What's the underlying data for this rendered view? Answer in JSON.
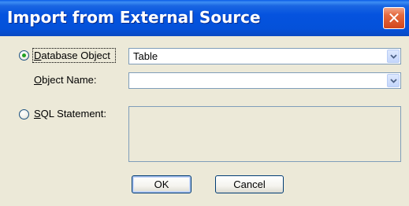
{
  "window": {
    "title": "Import from External Source",
    "close_glyph": "✕"
  },
  "options": {
    "database_object": {
      "label_mnemonic": "D",
      "label_rest": "atabase Object",
      "selected": true
    },
    "object_name": {
      "label_mnemonic": "O",
      "label_rest": "bject Name:"
    },
    "sql_statement": {
      "label_mnemonic": "S",
      "label_rest": "QL Statement:",
      "selected": false
    }
  },
  "fields": {
    "object_type": {
      "value": "Table"
    },
    "object_name": {
      "value": ""
    },
    "sql_statement": {
      "value": ""
    }
  },
  "buttons": {
    "ok": "OK",
    "cancel": "Cancel"
  },
  "icons": {
    "close": "close-icon",
    "dropdown": "chevron-down-icon",
    "radio_selected": "radio-selected",
    "radio_unselected": "radio-unselected"
  },
  "colors": {
    "titlebar": "#0553df",
    "close_button": "#d2461c",
    "dialog_bg": "#ece9d8",
    "field_border": "#7f9db9",
    "radio_dot": "#21a121"
  }
}
